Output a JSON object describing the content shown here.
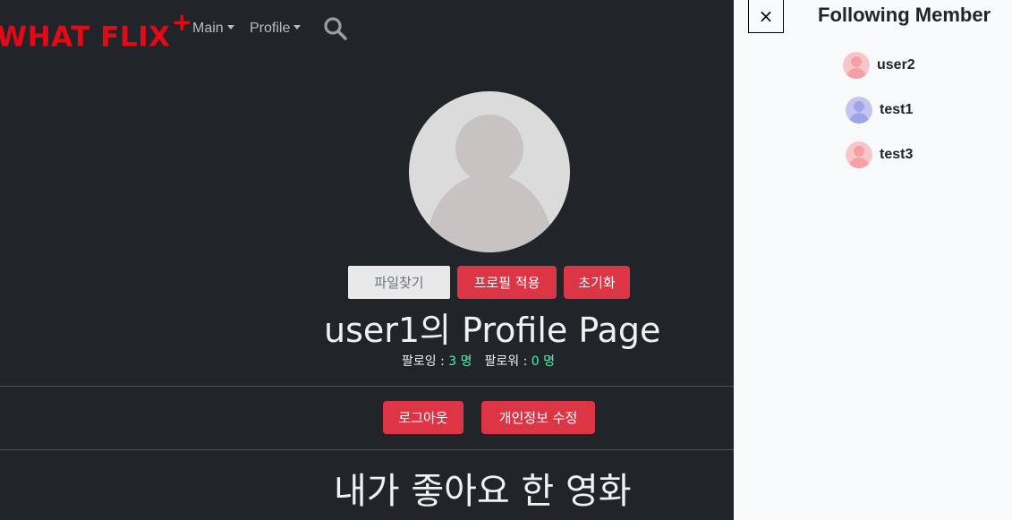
{
  "header": {
    "brand": "WHAT FLIX",
    "brand_plus": "+",
    "nav": [
      "Main",
      "Profile"
    ]
  },
  "profile": {
    "file_button": "파일찾기",
    "apply_button": "프로필 적용",
    "reset_button": "초기화",
    "title": "user1의 Profile Page",
    "following_label": "팔로잉 : ",
    "following_count": "3",
    "followers_label": "팔로워 : ",
    "followers_count": "0",
    "count_unit": "명",
    "logout_button": "로그아웃",
    "edit_button": "개인정보 수정",
    "liked_title": "내가 좋아요 한 영화"
  },
  "panel": {
    "close": "×",
    "title": "Following Member",
    "members": [
      {
        "name": "user2",
        "color": "#f4a0a6",
        "bg": "#f8c5c9"
      },
      {
        "name": "test1",
        "color": "#a0a3e8",
        "bg": "#c3c5f0"
      },
      {
        "name": "test3",
        "color": "#f4a0a6",
        "bg": "#f8c5c9"
      }
    ]
  },
  "colors": {
    "accent": "#dc3545",
    "brand": "#e50914",
    "count": "#4df2a8",
    "background": "#212429"
  },
  "icons": [
    "search-icon",
    "close-icon",
    "user-avatar-icon"
  ]
}
